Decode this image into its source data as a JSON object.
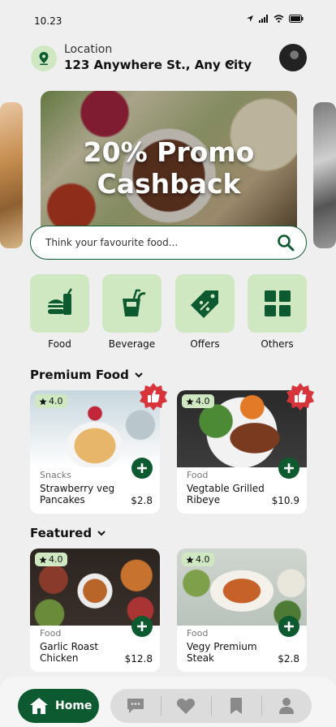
{
  "status_bar": {
    "time": "10.23"
  },
  "location": {
    "label": "Location",
    "address": "123 Anywhere St., Any City"
  },
  "banner": {
    "line1": "20% Promo",
    "line2": "Cashback"
  },
  "search": {
    "placeholder": "Think your favourite food..."
  },
  "categories": [
    {
      "label": "Food",
      "icon": "burger-drink-icon"
    },
    {
      "label": "Beverage",
      "icon": "drink-icon"
    },
    {
      "label": "Offers",
      "icon": "discount-tag-icon"
    },
    {
      "label": "Others",
      "icon": "grid-icon"
    }
  ],
  "premium": {
    "title": "Premium Food",
    "items": [
      {
        "rating": "4.0",
        "category": "Snacks",
        "name": "Strawberry veg Pancakes",
        "price": "$2.8",
        "badge": "thumbs-up-icon"
      },
      {
        "rating": "4.0",
        "category": "Food",
        "name": "Vegtable Grilled Ribeye",
        "price": "$10.9",
        "badge": "thumbs-up-icon"
      }
    ]
  },
  "featured": {
    "title": "Featured",
    "items": [
      {
        "rating": "4.0",
        "category": "Food",
        "name": "Garlic Roast Chicken",
        "price": "$12.8"
      },
      {
        "rating": "4.0",
        "category": "Food",
        "name": "Vegy Premium Steak",
        "price": "$2.8"
      }
    ]
  },
  "bottom_nav": {
    "home_label": "Home",
    "items": [
      "chat-icon",
      "heart-icon",
      "bookmark-icon",
      "profile-icon"
    ]
  },
  "colors": {
    "primary": "#0e5a30",
    "accent_light": "#cfe8c2",
    "badge_red": "#d8343c"
  }
}
